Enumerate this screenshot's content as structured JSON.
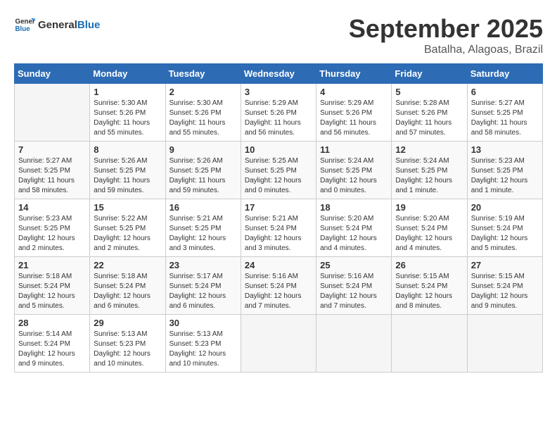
{
  "header": {
    "logo_general": "General",
    "logo_blue": "Blue",
    "title": "September 2025",
    "subtitle": "Batalha, Alagoas, Brazil"
  },
  "days_of_week": [
    "Sunday",
    "Monday",
    "Tuesday",
    "Wednesday",
    "Thursday",
    "Friday",
    "Saturday"
  ],
  "weeks": [
    [
      {
        "day": "",
        "sunrise": "",
        "sunset": "",
        "daylight": "",
        "empty": true
      },
      {
        "day": "1",
        "sunrise": "5:30 AM",
        "sunset": "5:26 PM",
        "daylight": "11 hours and 55 minutes."
      },
      {
        "day": "2",
        "sunrise": "5:30 AM",
        "sunset": "5:26 PM",
        "daylight": "11 hours and 55 minutes."
      },
      {
        "day": "3",
        "sunrise": "5:29 AM",
        "sunset": "5:26 PM",
        "daylight": "11 hours and 56 minutes."
      },
      {
        "day": "4",
        "sunrise": "5:29 AM",
        "sunset": "5:26 PM",
        "daylight": "11 hours and 56 minutes."
      },
      {
        "day": "5",
        "sunrise": "5:28 AM",
        "sunset": "5:26 PM",
        "daylight": "11 hours and 57 minutes."
      },
      {
        "day": "6",
        "sunrise": "5:27 AM",
        "sunset": "5:25 PM",
        "daylight": "11 hours and 58 minutes."
      }
    ],
    [
      {
        "day": "7",
        "sunrise": "5:27 AM",
        "sunset": "5:25 PM",
        "daylight": "11 hours and 58 minutes."
      },
      {
        "day": "8",
        "sunrise": "5:26 AM",
        "sunset": "5:25 PM",
        "daylight": "11 hours and 59 minutes."
      },
      {
        "day": "9",
        "sunrise": "5:26 AM",
        "sunset": "5:25 PM",
        "daylight": "11 hours and 59 minutes."
      },
      {
        "day": "10",
        "sunrise": "5:25 AM",
        "sunset": "5:25 PM",
        "daylight": "12 hours and 0 minutes."
      },
      {
        "day": "11",
        "sunrise": "5:24 AM",
        "sunset": "5:25 PM",
        "daylight": "12 hours and 0 minutes."
      },
      {
        "day": "12",
        "sunrise": "5:24 AM",
        "sunset": "5:25 PM",
        "daylight": "12 hours and 1 minute."
      },
      {
        "day": "13",
        "sunrise": "5:23 AM",
        "sunset": "5:25 PM",
        "daylight": "12 hours and 1 minute."
      }
    ],
    [
      {
        "day": "14",
        "sunrise": "5:23 AM",
        "sunset": "5:25 PM",
        "daylight": "12 hours and 2 minutes."
      },
      {
        "day": "15",
        "sunrise": "5:22 AM",
        "sunset": "5:25 PM",
        "daylight": "12 hours and 2 minutes."
      },
      {
        "day": "16",
        "sunrise": "5:21 AM",
        "sunset": "5:25 PM",
        "daylight": "12 hours and 3 minutes."
      },
      {
        "day": "17",
        "sunrise": "5:21 AM",
        "sunset": "5:24 PM",
        "daylight": "12 hours and 3 minutes."
      },
      {
        "day": "18",
        "sunrise": "5:20 AM",
        "sunset": "5:24 PM",
        "daylight": "12 hours and 4 minutes."
      },
      {
        "day": "19",
        "sunrise": "5:20 AM",
        "sunset": "5:24 PM",
        "daylight": "12 hours and 4 minutes."
      },
      {
        "day": "20",
        "sunrise": "5:19 AM",
        "sunset": "5:24 PM",
        "daylight": "12 hours and 5 minutes."
      }
    ],
    [
      {
        "day": "21",
        "sunrise": "5:18 AM",
        "sunset": "5:24 PM",
        "daylight": "12 hours and 5 minutes."
      },
      {
        "day": "22",
        "sunrise": "5:18 AM",
        "sunset": "5:24 PM",
        "daylight": "12 hours and 6 minutes."
      },
      {
        "day": "23",
        "sunrise": "5:17 AM",
        "sunset": "5:24 PM",
        "daylight": "12 hours and 6 minutes."
      },
      {
        "day": "24",
        "sunrise": "5:16 AM",
        "sunset": "5:24 PM",
        "daylight": "12 hours and 7 minutes."
      },
      {
        "day": "25",
        "sunrise": "5:16 AM",
        "sunset": "5:24 PM",
        "daylight": "12 hours and 7 minutes."
      },
      {
        "day": "26",
        "sunrise": "5:15 AM",
        "sunset": "5:24 PM",
        "daylight": "12 hours and 8 minutes."
      },
      {
        "day": "27",
        "sunrise": "5:15 AM",
        "sunset": "5:24 PM",
        "daylight": "12 hours and 9 minutes."
      }
    ],
    [
      {
        "day": "28",
        "sunrise": "5:14 AM",
        "sunset": "5:24 PM",
        "daylight": "12 hours and 9 minutes."
      },
      {
        "day": "29",
        "sunrise": "5:13 AM",
        "sunset": "5:23 PM",
        "daylight": "12 hours and 10 minutes."
      },
      {
        "day": "30",
        "sunrise": "5:13 AM",
        "sunset": "5:23 PM",
        "daylight": "12 hours and 10 minutes."
      },
      {
        "day": "",
        "sunrise": "",
        "sunset": "",
        "daylight": "",
        "empty": true
      },
      {
        "day": "",
        "sunrise": "",
        "sunset": "",
        "daylight": "",
        "empty": true
      },
      {
        "day": "",
        "sunrise": "",
        "sunset": "",
        "daylight": "",
        "empty": true
      },
      {
        "day": "",
        "sunrise": "",
        "sunset": "",
        "daylight": "",
        "empty": true
      }
    ]
  ]
}
